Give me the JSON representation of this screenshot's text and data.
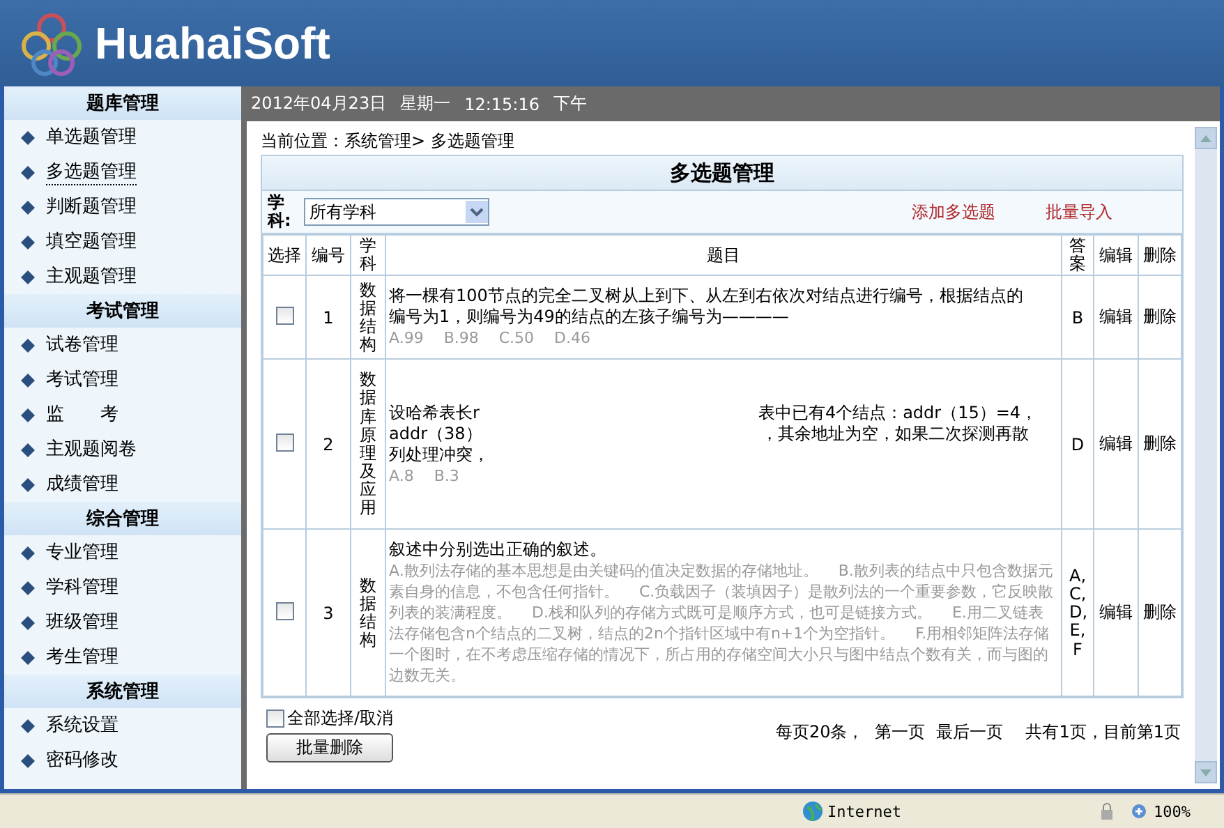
{
  "header": {
    "logo_text": "HuahaiSoft"
  },
  "sidebar": {
    "groups": [
      {
        "title": "题库管理",
        "items": [
          {
            "label": "单选题管理",
            "selected": false
          },
          {
            "label": "多选题管理",
            "selected": true
          },
          {
            "label": "判断题管理",
            "selected": false
          },
          {
            "label": "填空题管理",
            "selected": false
          },
          {
            "label": "主观题管理",
            "selected": false
          }
        ]
      },
      {
        "title": "考试管理",
        "items": [
          {
            "label": "试卷管理",
            "selected": false
          },
          {
            "label": "考试管理",
            "selected": false
          },
          {
            "label": "监　　考",
            "selected": false
          },
          {
            "label": "主观题阅卷",
            "selected": false
          },
          {
            "label": "成绩管理",
            "selected": false
          }
        ]
      },
      {
        "title": "综合管理",
        "items": [
          {
            "label": "专业管理",
            "selected": false
          },
          {
            "label": "学科管理",
            "selected": false
          },
          {
            "label": "班级管理",
            "selected": false
          },
          {
            "label": "考生管理",
            "selected": false
          }
        ]
      },
      {
        "title": "系统管理",
        "items": [
          {
            "label": "系统设置",
            "selected": false
          },
          {
            "label": "密码修改",
            "selected": false
          }
        ]
      }
    ]
  },
  "datebar": {
    "date": "2012年04月23日",
    "weekday": "星期一",
    "time": "12:15:16",
    "ampm": "下午"
  },
  "breadcrumb": "当前位置：系统管理> 多选题管理",
  "panel": {
    "title": "多选题管理",
    "filter_label": "学科:",
    "filter_value": "所有学科",
    "links": [
      "添加多选题",
      "批量导入"
    ]
  },
  "table": {
    "columns": [
      "选择",
      "编号",
      "学科",
      "题目",
      "答案",
      "编辑",
      "删除"
    ],
    "rows": [
      {
        "checked": false,
        "number": "1",
        "subject": "数据结构",
        "question_lines": [
          [
            "将一棵有100节点的完全二叉树从上到下、从左到右依次对结点进行编号，根据结点的"
          ],
          [
            "编号为1，则编号为49的结点的左孩子编号为————"
          ]
        ],
        "options": "A.99　 B.98　 C.50　 D.46",
        "answer": "B",
        "edit": "编辑",
        "delete": "删除"
      },
      {
        "checked": false,
        "number": "2",
        "subject": "数据库原理及应用",
        "question_lines": [
          [
            "设哈希表长r",
            "表中已有4个结点：addr（15）=4，"
          ],
          [
            "addr（38）",
            "，其余地址为空，如果二次探测再散"
          ],
          [
            "列处理冲突，"
          ]
        ],
        "options": "A.8　 B.3",
        "answer": "D",
        "edit": "编辑",
        "delete": "删除"
      },
      {
        "checked": false,
        "number": "3",
        "subject": "数据结构",
        "question_lines": [
          [
            "叙述中分别选出正确的叙述。"
          ]
        ],
        "options": "A.散列法存储的基本思想是由关键码的值决定数据的存储地址。　 B.散列表的结点中只包含数据元素自身的信息，不包含任何指针。　 C.负载因子（装填因子）是散列法的一个重要参数，它反映散列表的装满程度。　 D.栈和队列的存储方式既可是顺序方式，也可是链接方式。　 E.用二叉链表法存储包含n个结点的二叉树，结点的2n个指针区域中有n+1个为空指针。　 F.用相邻矩阵法存储一个图时，在不考虑压缩存储的情况下，所占用的存储空间大小只与图中结点个数有关，而与图的边数无关。",
        "answer": "A,C,D,E,F",
        "edit": "编辑",
        "delete": "删除"
      }
    ]
  },
  "select_all": {
    "label": "全部选择/取消",
    "checked": false
  },
  "batch_delete": "批量删除",
  "pager": [
    "每页20条，",
    "第一页",
    "最后一页",
    "共有1页，目前第1页"
  ],
  "status_bar": {
    "zone": "Internet",
    "zoom": "100%"
  }
}
